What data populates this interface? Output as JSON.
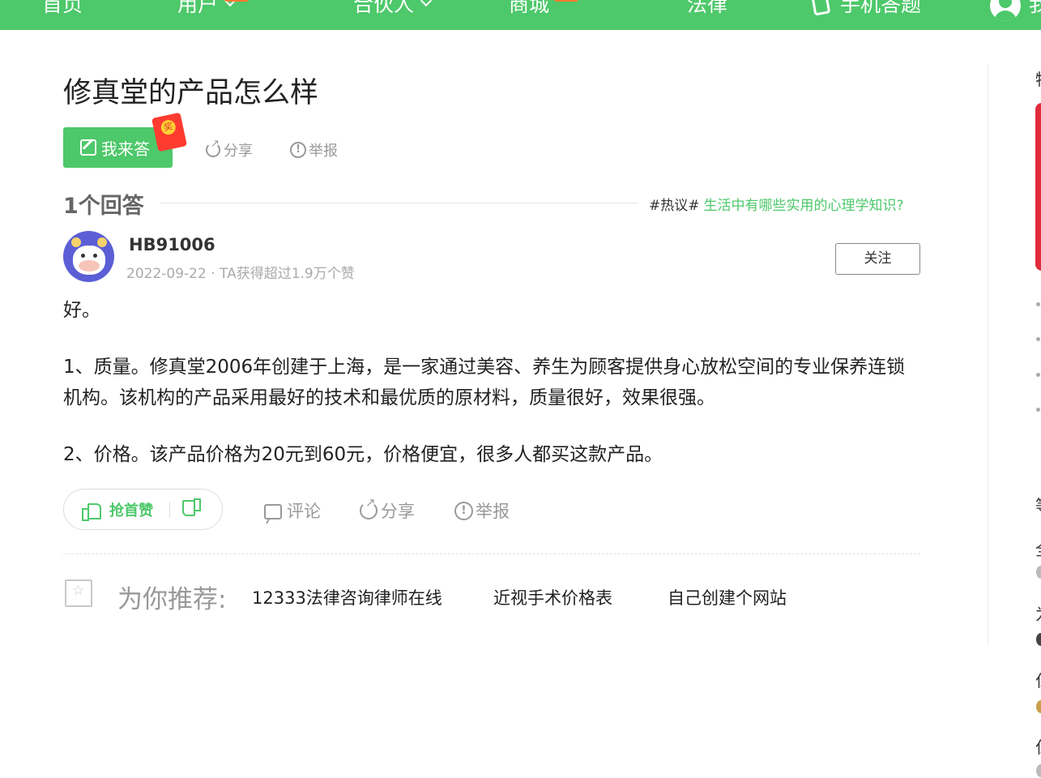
{
  "nav": {
    "items": [
      "首页",
      "用户",
      "合伙人",
      "商城",
      "法律",
      "手机答题",
      "我"
    ]
  },
  "question": {
    "title": "修真堂的产品怎么样",
    "answer_button": "我来答",
    "redpacket_label": "奖",
    "share": "分享",
    "report": "举报"
  },
  "answers": {
    "count_label": "1个回答",
    "hot_tag": "#热议#",
    "hot_link": "生活中有哪些实用的心理学知识?"
  },
  "answer": {
    "user_name": "HB91006",
    "meta": "2022-09-22 · TA获得超过1.9万个赞",
    "follow": "关注",
    "paragraphs": [
      "好。",
      "1、质量。修真堂2006年创建于上海，是一家通过美容、养生为顾客提供身心放松空间的专业保养连锁机构。该机构的产品采用最好的技术和最优质的原材料，质量很好，效果很强。",
      "2、价格。该产品价格为20元到60元，价格便宜，很多人都买这款产品。"
    ],
    "like_label": "抢首赞",
    "comment": "评论",
    "share": "分享",
    "report": "举报"
  },
  "recommend": {
    "label": "为你推荐:",
    "links": [
      "12333法律咨询律师在线",
      "近视手术价格表",
      "自己创建个网站"
    ]
  },
  "sidebar": {
    "chars": [
      "特",
      "等",
      "全",
      "为",
      "仁",
      "仁"
    ]
  },
  "colors": {
    "brand_green": "#4dc86a",
    "badge_orange": "#ff7a2f",
    "red": "#e02b3b"
  }
}
